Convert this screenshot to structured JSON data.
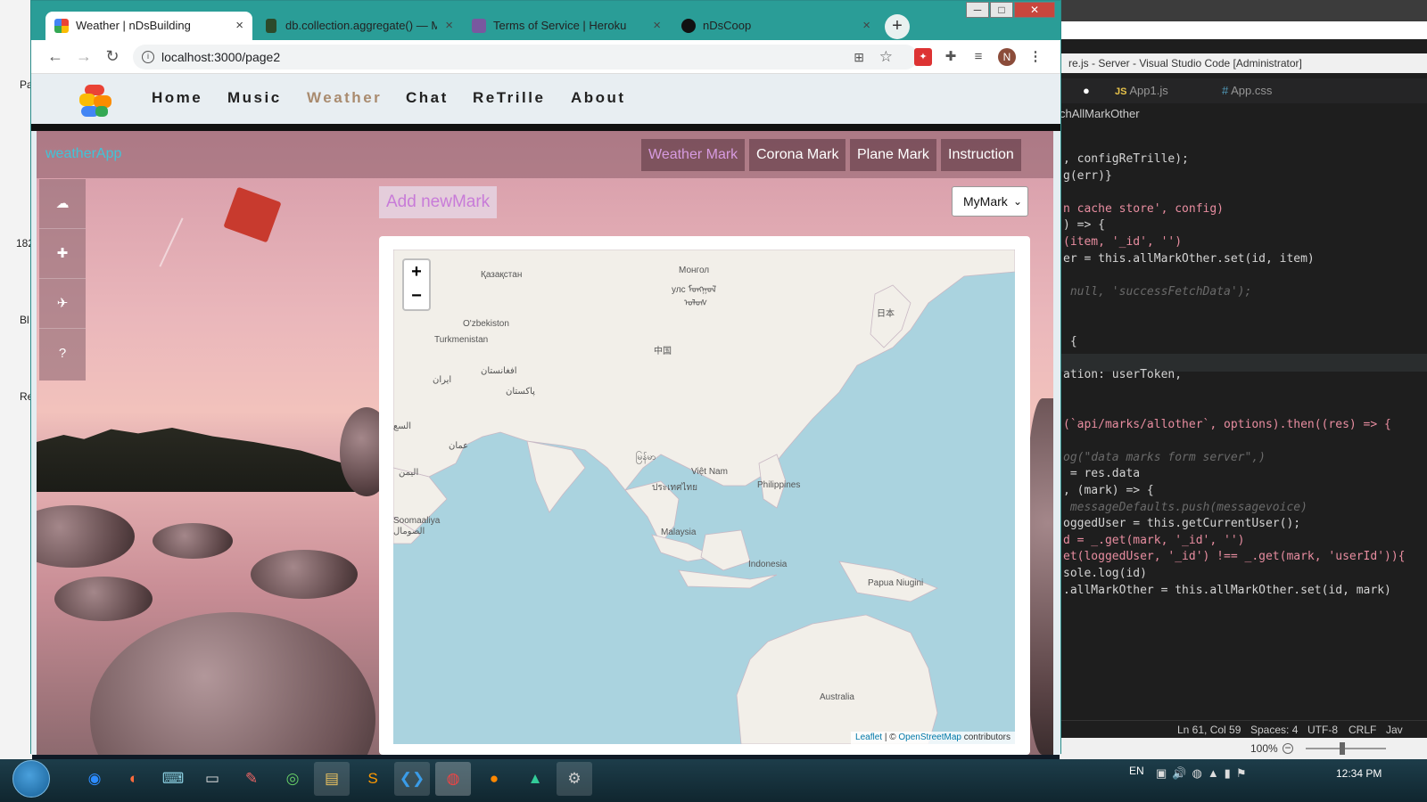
{
  "browser": {
    "tabs": [
      {
        "title": "Weather | nDsBuilding",
        "active": true
      },
      {
        "title": "db.collection.aggregate() — Mon",
        "active": false
      },
      {
        "title": "Terms of Service | Heroku",
        "active": false
      },
      {
        "title": "nDsCoop",
        "active": false
      }
    ],
    "new_tab": "+",
    "url": "localhost:3000/page2",
    "profile_initial": "N",
    "window_controls": {
      "minimize": "─",
      "maximize": "□",
      "close": "✕"
    }
  },
  "site_nav": {
    "items": [
      "Home",
      "Music",
      "Weather",
      "Chat",
      "ReTrille",
      "About"
    ],
    "active": "Weather"
  },
  "weather_app": {
    "app_name": "weatherApp",
    "menu": [
      "Weather Mark",
      "Corona Mark",
      "Plane Mark",
      "Instruction"
    ],
    "active_menu": "Weather Mark",
    "sidebar_icons": [
      "cloud-sun-icon",
      "first-aid-icon",
      "plane-icon",
      "help-circle-icon"
    ],
    "add_mark_label": "Add newMark",
    "mark_select": {
      "selected": "MyMark"
    },
    "map": {
      "zoom_in": "+",
      "zoom_out": "−",
      "labels": [
        "Қазақстан",
        "Монгол",
        "улс ᠮᠣᠩᠭᠣᠯ",
        "ᠤᠯᠤᠰ",
        "O'zbekiston",
        "Turkmenistan",
        "中国",
        "日本",
        "افغانستان",
        "ایران",
        "پاکستان",
        "السع",
        "عمان",
        "اليمن",
        "မြန်မာ",
        "Việt Nam",
        "ประเทศไทย",
        "Philippines",
        "Malaysia",
        "Indonesia",
        "Papua Niugini",
        "Soomaaliya",
        "الصومال",
        "Australia"
      ],
      "attribution": {
        "leaflet": "Leaflet",
        "separator": " | © ",
        "osm": "OpenStreetMap",
        "suffix": " contributors"
      }
    }
  },
  "vscode": {
    "title": "re.js - Server - Visual Studio Code [Administrator]",
    "tabs": [
      "App1.js",
      "App.css"
    ],
    "tab_prefixes": [
      "JS",
      "#"
    ],
    "breadcrumb": "chAllMarkOther",
    "code_lines": [
      ", configReTrille);",
      "g(err)}",
      "",
      "n cache store', config)",
      ") => {",
      "(item, '_id', '')",
      "er = this.allMarkOther.set(id, item)",
      "",
      " null, 'successFetchData');",
      "",
      "",
      " {",
      "",
      "ation: userToken,",
      "",
      "",
      "(`api/marks/allother`, options).then((res) => {",
      "",
      "og(\"data marks form server\",)",
      " = res.data",
      ", (mark) => {",
      " messageDefaults.push(messagevoice)",
      "oggedUser = this.getCurrentUser();",
      "d = _.get(mark, '_id', '')",
      "et(loggedUser, '_id') !== _.get(mark, 'userId')){",
      "sole.log(id)",
      ".allMarkOther = this.allMarkOther.set(id, mark)"
    ],
    "status": [
      "Ln 61, Col 59",
      "Spaces: 4",
      "UTF-8",
      "CRLF",
      "Jav"
    ],
    "zoom": "100%"
  },
  "desktop_left_labels": [
    "Pa",
    "182",
    "Bl",
    "Re"
  ],
  "taskbar": {
    "language": "EN",
    "time": "12:34 PM",
    "apps": [
      "zoom-icon",
      "media-player-icon",
      "keyboard-icon",
      "terminal-icon",
      "paint-icon",
      "browser-icon",
      "folder-icon",
      "sublime-icon",
      "vscode-icon",
      "chrome-icon",
      "firefox-icon",
      "app-icon",
      "settings-icon"
    ]
  },
  "colors": {
    "chrome_frame": "#2a9d97",
    "weather_active": "#a98b6f",
    "app_name": "#40c4d8",
    "add_mark": "#c87bd8",
    "map_water": "#aad3df",
    "map_land": "#f2efe9"
  }
}
